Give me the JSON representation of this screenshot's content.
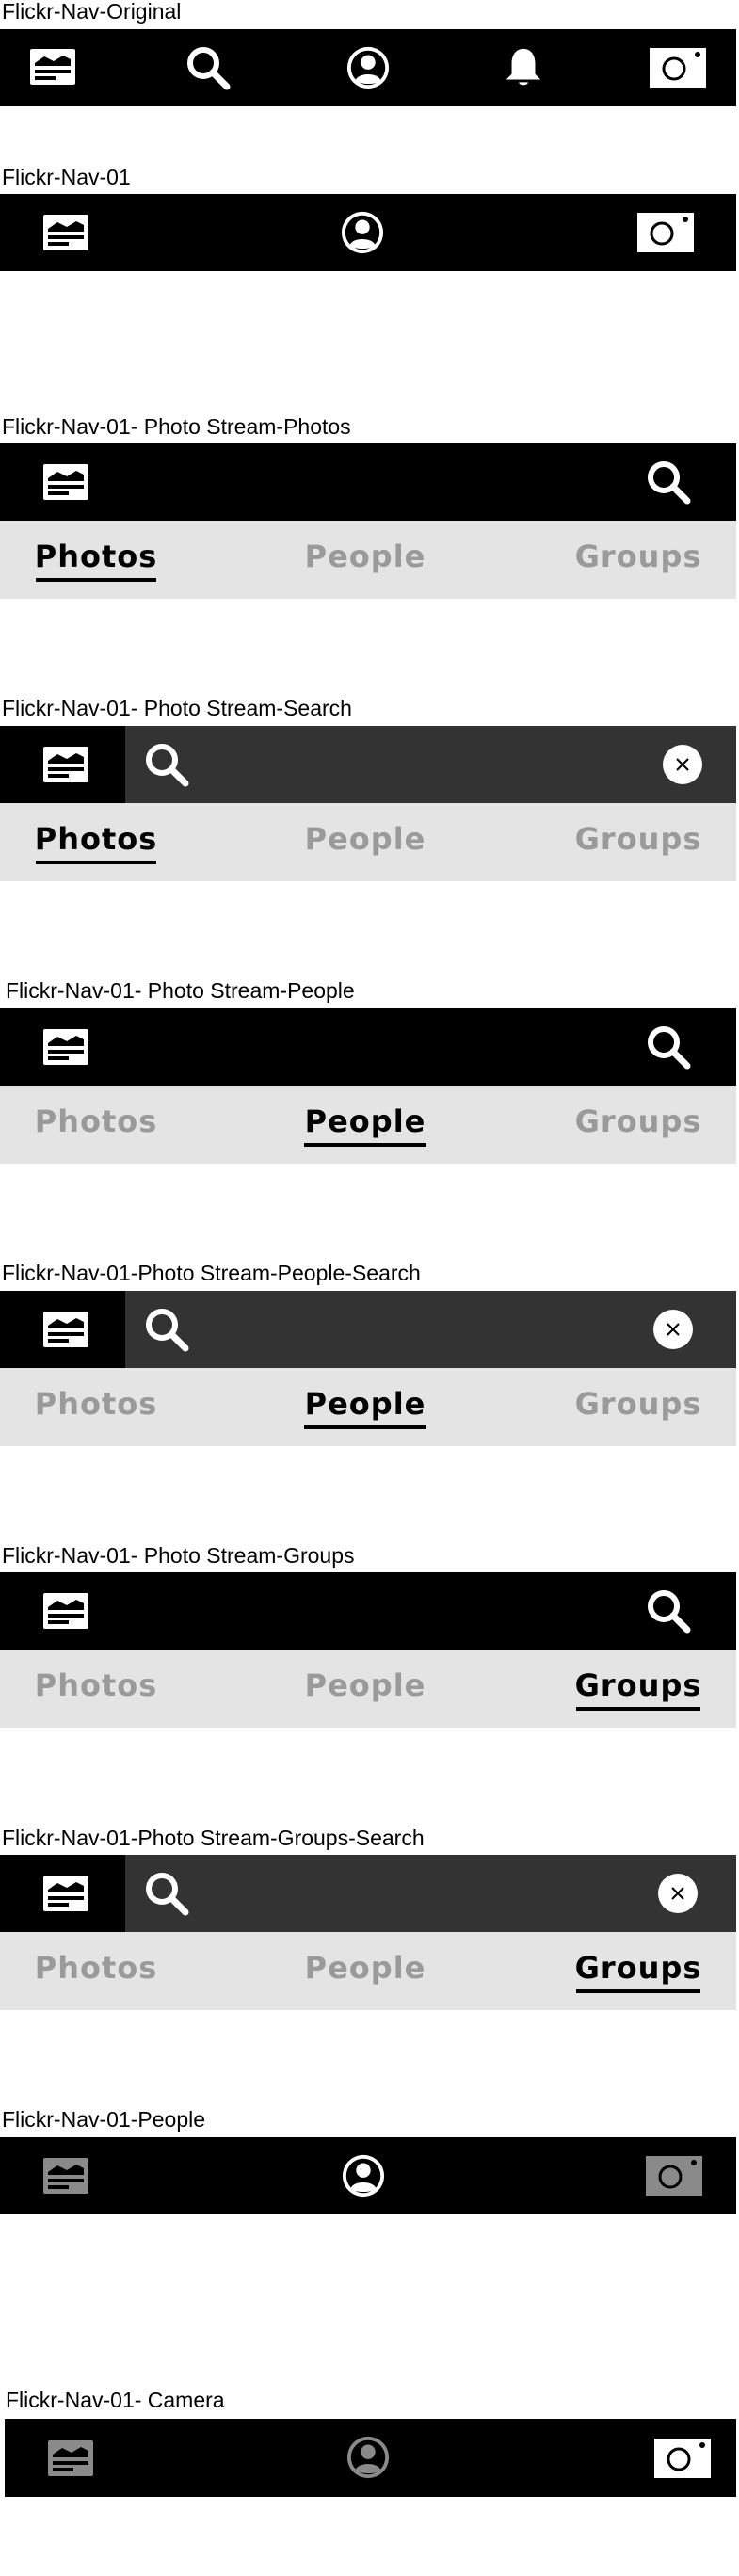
{
  "sections": [
    {
      "label": "Flickr-Nav-Original"
    },
    {
      "label": "Flickr-Nav-01"
    },
    {
      "label": "Flickr-Nav-01- Photo Stream-Photos"
    },
    {
      "label": "Flickr-Nav-01- Photo Stream-Search"
    },
    {
      "label": "Flickr-Nav-01- Photo Stream-People"
    },
    {
      "label": "Flickr-Nav-01-Photo Stream-People-Search"
    },
    {
      "label": "Flickr-Nav-01- Photo Stream-Groups"
    },
    {
      "label": "Flickr-Nav-01-Photo Stream-Groups-Search"
    },
    {
      "label": "Flickr-Nav-01-People"
    },
    {
      "label": "Flickr-Nav-01- Camera"
    }
  ],
  "tabs": {
    "photos": "Photos",
    "people": "People",
    "groups": "Groups"
  },
  "icons": {
    "photostream": "photostream-icon",
    "search": "search-icon",
    "profile": "profile-icon",
    "notifications": "bell-icon",
    "camera": "camera-icon",
    "clear": "clear-icon"
  },
  "colors": {
    "bar": "#000000",
    "search_field": "#333333",
    "tab_bar": "#e4e4e4",
    "tab_active": "#000000",
    "tab_inactive": "#9a9a9a",
    "icon_active": "#ffffff",
    "icon_dimmed": "#8a8a8a"
  }
}
